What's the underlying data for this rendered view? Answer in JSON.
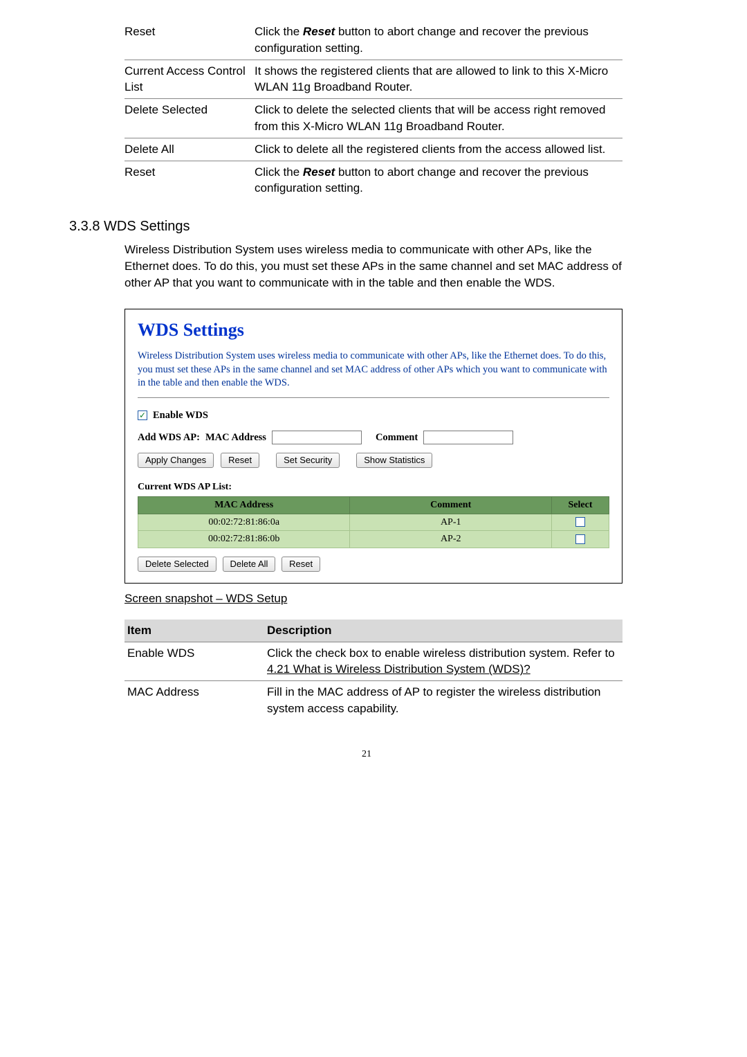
{
  "upper_table": {
    "rows": [
      {
        "term": "Reset",
        "desc_a": "Click the ",
        "desc_bold": "Reset",
        "desc_b": " button to abort change and recover the previous configuration setting."
      },
      {
        "term": "Current Access Control List",
        "desc_plain": "It shows the registered clients that are allowed to link to this X-Micro WLAN 11g Broadband Router."
      },
      {
        "term": "Delete Selected",
        "desc_plain": "Click to delete the selected clients that will be access right removed from this X-Micro WLAN 11g Broadband Router."
      },
      {
        "term": "Delete All",
        "desc_plain": "Click to delete all the registered clients from the access allowed list."
      },
      {
        "term": "Reset",
        "desc_a": "Click the ",
        "desc_bold": "Reset",
        "desc_b": " button to abort change and recover the previous configuration setting."
      }
    ]
  },
  "section": {
    "heading": "3.3.8 WDS Settings",
    "body": "Wireless Distribution System uses wireless media to communicate with other APs, like the Ethernet does. To do this, you must set these APs in the same channel and set MAC address of other AP that you want to communicate with in the table and then enable the WDS."
  },
  "wds": {
    "title": "WDS Settings",
    "intro": "Wireless Distribution System uses wireless media to communicate with other APs, like the Ethernet does. To do this, you must set these APs in the same channel and set MAC address of other APs which you want to communicate with in the table and then enable the WDS.",
    "enable_label": "Enable WDS",
    "add_ap_prefix": "Add WDS AP:",
    "mac_label": "MAC Address",
    "comment_label": "Comment",
    "btn_apply": "Apply Changes",
    "btn_reset": "Reset",
    "btn_setsec": "Set Security",
    "btn_showstat": "Show Statistics",
    "list_title": "Current WDS AP List:",
    "headers": {
      "mac": "MAC Address",
      "comment": "Comment",
      "select": "Select"
    },
    "rows": [
      {
        "mac": "00:02:72:81:86:0a",
        "comment": "AP-1"
      },
      {
        "mac": "00:02:72:81:86:0b",
        "comment": "AP-2"
      }
    ],
    "btn_delsel": "Delete Selected",
    "btn_delall": "Delete All",
    "btn_reset2": "Reset"
  },
  "caption": "Screen snapshot – WDS Setup",
  "desc_table": {
    "head_item": "Item",
    "head_desc": "Description",
    "enable_wds_label": "Enable WDS",
    "enable_wds_pre": "Click the check box to enable wireless distribution system. Refer to ",
    "enable_wds_link": "4.21 What is Wireless Distribution System (WDS)?",
    "mac_label": "MAC Address",
    "mac_desc": "Fill in the MAC address of AP to register the wireless distribution system access capability."
  },
  "page_number": "21"
}
